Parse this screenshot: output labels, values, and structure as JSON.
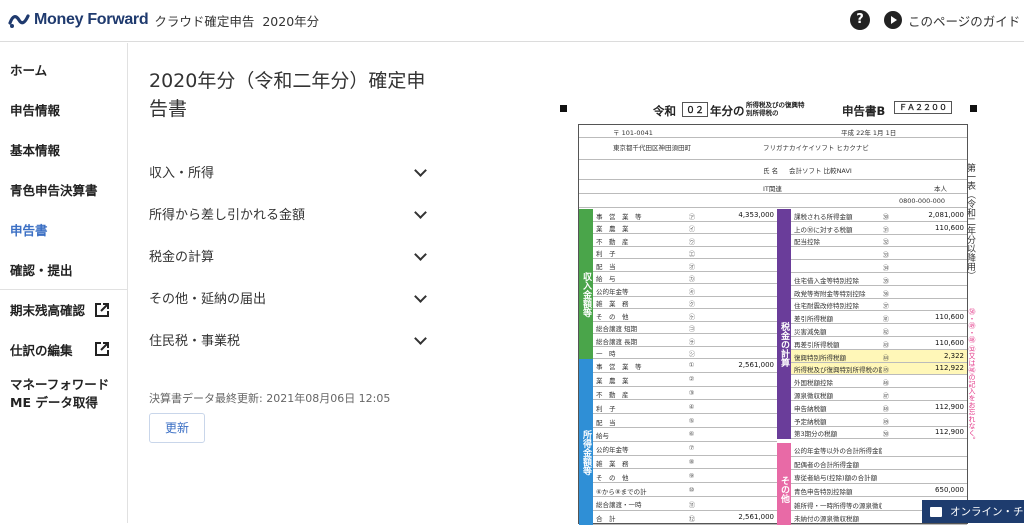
{
  "header": {
    "brand_name": "Money Forward",
    "product": "クラウド確定申告",
    "year": "2020年分",
    "help_icon": "question-circle-icon",
    "guide_label": "このページのガイド"
  },
  "sidebar": {
    "items": [
      {
        "label": "ホーム"
      },
      {
        "label": "申告情報"
      },
      {
        "label": "基本情報"
      },
      {
        "label": "青色申告決算書"
      },
      {
        "label": "申告書"
      },
      {
        "label": "確認・提出"
      },
      {
        "label": "期末残高確認"
      },
      {
        "label": "仕訳の編集"
      },
      {
        "label": "マネーフォワード ME データ取得"
      }
    ]
  },
  "main": {
    "title": "2020年分（令和二年分）確定申告書",
    "sections": [
      {
        "label": "収入・所得"
      },
      {
        "label": "所得から差し引かれる金額"
      },
      {
        "label": "税金の計算"
      },
      {
        "label": "その他・延納の届出"
      },
      {
        "label": "住民税・事業税"
      }
    ],
    "updated_text": "決算書データ最終更新: 2021年08月06日 12:05",
    "refresh_label": "更新"
  },
  "form": {
    "era": "令和",
    "year_box": "０２",
    "year_suffix": "年分の",
    "tax_kind": "所得税及びの復興特別所得税の",
    "form_name": "申告書B",
    "form_code": "ＦＡ２２００",
    "postal": "〒 101-0041",
    "address": "東京都千代田区神田須田町",
    "furigana_label": "フリガナ",
    "furigana": "カイケイソフト ヒカクナビ",
    "name_label": "氏 名",
    "name": "会計ソフト 比較NAVI",
    "occupation": "IT関連",
    "relation": "本人",
    "phone": "0800-000-000",
    "birth": "平成 22年 1月 1日",
    "left_income_header": "収入金額等",
    "left_income_items": [
      "事　営　業　等",
      "業　農　業",
      "不　動　産",
      "利　子",
      "配　当",
      "給　与",
      "公的年金等",
      "雑　業　務",
      "そ　の　他",
      "総合譲渡 短期",
      "総合譲渡 長期",
      "一　時"
    ],
    "left_income_amounts": [
      "4,353,000",
      "",
      "",
      "",
      "",
      "",
      "",
      "",
      "",
      "",
      "",
      ""
    ],
    "left_income_markers": [
      "㋐",
      "㋑",
      "㋒",
      "㋓",
      "㋔",
      "㋕",
      "㋖",
      "㋗",
      "㋘",
      "㋙",
      "㋚",
      "㋛"
    ],
    "left_shotoku_header": "所得金額等",
    "left_shotoku_items": [
      "事　営　業　等",
      "業　農　業",
      "不　動　産",
      "利　子",
      "配　当",
      "給与",
      "公的年金等",
      "雑　業　務",
      "そ　の　他",
      "⑥から⑧までの計",
      "総合譲渡・一時",
      "合　計"
    ],
    "left_shotoku_amounts": [
      "2,561,000",
      "",
      "",
      "",
      "",
      "",
      "",
      "",
      "",
      "",
      "",
      "2,561,000"
    ],
    "left_shotoku_markers": [
      "①",
      "②",
      "③",
      "④",
      "⑤",
      "⑥",
      "⑦",
      "⑧",
      "⑨",
      "⑩",
      "⑪",
      "⑫"
    ],
    "right_tax_header": "税金の計算",
    "right_tax_items": [
      "課税される所得金額",
      "上の㉚に対する税額",
      "配当控除",
      "",
      "",
      "住宅借入金等特別控除",
      "政党等寄附金等特別控除",
      "住宅耐震改修特別控除",
      "差引所得税額",
      "災害減免額",
      "再差引所得税額",
      "復興特別所得税額",
      "所得税及び復興特別所得税の額",
      "外国税額控除",
      "源泉徴収税額",
      "申告納税額",
      "予定納税額",
      "第3期分の税額"
    ],
    "right_tax_amounts": [
      "2,081,000",
      "110,600",
      "",
      "",
      "",
      "",
      "",
      "",
      "110,600",
      "",
      "110,600",
      "2,322",
      "112,922",
      "",
      "",
      "112,900",
      "",
      "112,900"
    ],
    "right_tax_markers": [
      "㉚",
      "㉛",
      "㉜",
      "㉝",
      "㉞",
      "㉟",
      "㊱",
      "㊲",
      "㊶",
      "㊷",
      "㊸",
      "㊹",
      "㊺",
      "㊻",
      "㊼",
      "㊽",
      "㊾",
      "㊿"
    ],
    "right_other_header": "その他",
    "right_other_items": [
      "公的年金等以外の合計所得金額",
      "配偶者の合計所得金額",
      "専従者給与(控除)額の合計額",
      "青色申告特別控除額",
      "雑所得・一時所得等の源泉徴収税額",
      "未納付の源泉徴収税額"
    ],
    "right_other_amounts": [
      "",
      "",
      "",
      "650,000",
      "",
      ""
    ],
    "side_vertical": "第一表（令和二年分以降用）",
    "side_note": "㊿・㊾・㊽ ㉜又は㊻の記入をお忘れなく。"
  },
  "chat": {
    "label": "オンライン・チ"
  }
}
